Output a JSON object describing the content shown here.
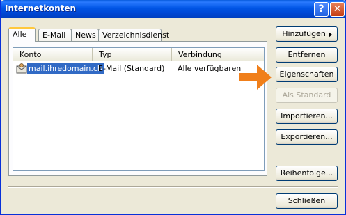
{
  "window": {
    "title": "Internetkonten",
    "help_glyph": "?",
    "close_glyph": "✕"
  },
  "tabs": [
    {
      "label": "Alle",
      "active": true
    },
    {
      "label": "E-Mail",
      "active": false
    },
    {
      "label": "News",
      "active": false
    },
    {
      "label": "Verzeichnisdienst",
      "active": false
    }
  ],
  "list": {
    "columns": [
      "Konto",
      "Typ",
      "Verbindung"
    ],
    "rows": [
      {
        "konto": "mail.ihredomain.ch",
        "typ": "E-Mail (Standard)",
        "verbindung": "Alle verfügbaren",
        "icon": "mail-account-icon",
        "selected": true
      }
    ]
  },
  "buttons": {
    "add": "Hinzufügen",
    "remove": "Entfernen",
    "properties": "Eigenschaften",
    "set_default": "Als Standard",
    "import": "Importieren...",
    "export": "Exportieren...",
    "order": "Reihenfolge...",
    "close": "Schließen"
  },
  "colors": {
    "titlebar": "#0055e5",
    "selection": "#316ac5",
    "pointer_arrow": "#f07f1a"
  }
}
